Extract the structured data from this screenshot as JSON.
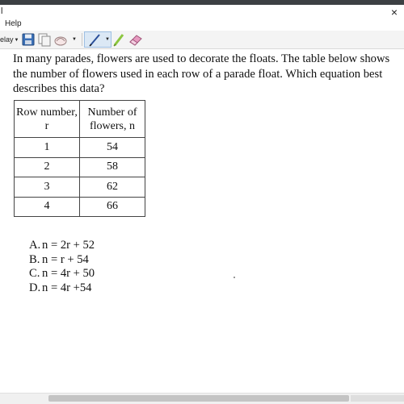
{
  "window": {
    "title_fragment": "l",
    "close_glyph": "×"
  },
  "menu": {
    "help_label": "Help"
  },
  "toolbar": {
    "delay_label": "elay",
    "icons": [
      "save-icon",
      "copy-icon",
      "stamp-icon",
      "pen-icon",
      "highlighter-icon",
      "eraser-icon"
    ],
    "accent_color": "#dbe8f5"
  },
  "document": {
    "question": "In many parades, flowers are used to decorate the floats. The table below shows the number of flowers used in each row of a parade float. Which equation best describes this data?",
    "table": {
      "headers": [
        "Row number, r",
        "Number of flowers, n"
      ],
      "rows": [
        [
          "1",
          "54"
        ],
        [
          "2",
          "58"
        ],
        [
          "3",
          "62"
        ],
        [
          "4",
          "66"
        ]
      ]
    },
    "choices": [
      {
        "letter": "A.",
        "text": "n = 2r + 52"
      },
      {
        "letter": "B.",
        "text": "n = r + 54"
      },
      {
        "letter": "C.",
        "text": "n = 4r + 50"
      },
      {
        "letter": "D.",
        "text": "n = 4r +54"
      }
    ]
  },
  "scrollbar": {
    "horizontal_position": 0.12
  }
}
